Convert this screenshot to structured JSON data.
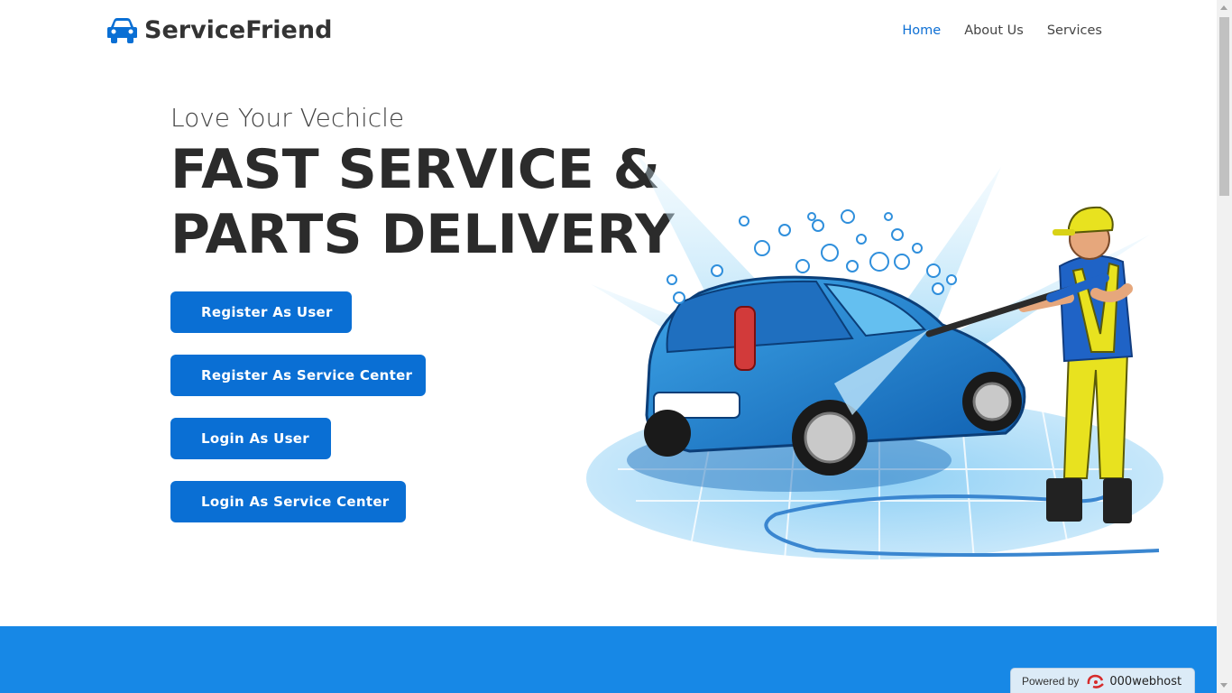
{
  "header": {
    "brand_icon": "car-icon",
    "brand_name": "ServiceFriend",
    "nav": [
      {
        "label": "Home",
        "active": true
      },
      {
        "label": "About Us",
        "active": false
      },
      {
        "label": "Services",
        "active": false
      }
    ]
  },
  "hero": {
    "subtitle": "Love Your Vechicle",
    "title_line1": "FAST SERVICE &",
    "title_line2": "PARTS DELIVERY",
    "buttons": [
      "Register As User",
      "Register As Service Center",
      "Login As User",
      "Login As Service Center"
    ],
    "illustration": "car-wash-illustration"
  },
  "badge": {
    "powered_by": "Powered by",
    "host_name": "000webhost",
    "icon": "000webhost-logo-icon"
  },
  "colors": {
    "accent": "#0a6fd4",
    "band": "#1788e6",
    "nav_active": "#0d6fd4",
    "text_dark": "#2b2b2b"
  }
}
